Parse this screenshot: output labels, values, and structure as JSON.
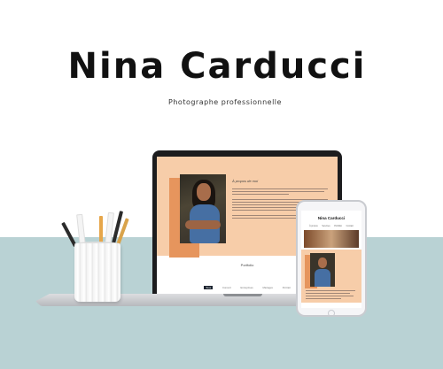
{
  "header": {
    "title": "Nina Carducci",
    "subtitle": "Photographe  professionnelle"
  },
  "laptop_site": {
    "about_heading": "À propos de moi",
    "section_title": "Portfolio",
    "tabs": [
      "Tous",
      "Concert",
      "Entreprises",
      "Mariages",
      "Portrait"
    ],
    "active_tab_index": 0
  },
  "phone_site": {
    "title": "Nina Carducci",
    "nav": [
      "À propos",
      "Services",
      "Portfolio",
      "Contact"
    ]
  },
  "colors": {
    "peach": "#f7cda9",
    "orange": "#e6955d",
    "desk": "#b9d2d4"
  }
}
